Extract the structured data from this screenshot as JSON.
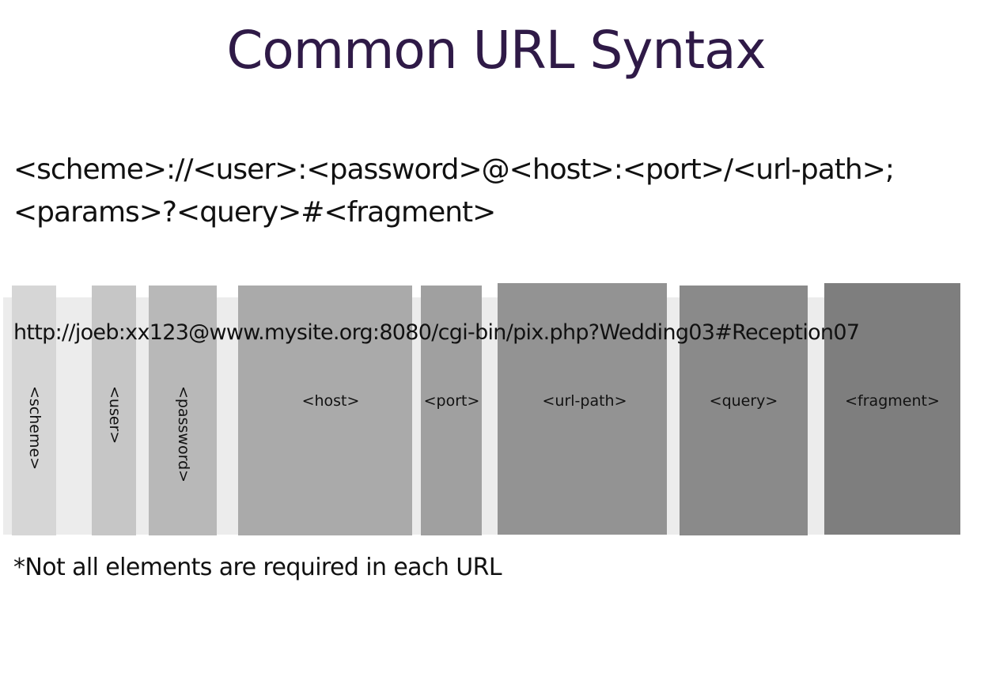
{
  "title": "Common URL Syntax",
  "syntax": {
    "line1": "<scheme>://<user>:<password>@<host>:<port>/<url-path>;",
    "line2": "<params>?<query>#<fragment>"
  },
  "diagram": {
    "example_url": "http://joeb:xx123@www.mysite.org:8080/cgi-bin/pix.php?Wedding03#Reception07",
    "components": [
      {
        "label": "<scheme>",
        "orientation": "vertical",
        "color": "#d6d6d6"
      },
      {
        "label": "<user>",
        "orientation": "vertical",
        "color": "#c6c6c6"
      },
      {
        "label": "<password>",
        "orientation": "vertical",
        "color": "#b8b8b8"
      },
      {
        "label": "<host>",
        "orientation": "horizontal",
        "color": "#aaaaaa"
      },
      {
        "label": "<port>",
        "orientation": "horizontal",
        "color": "#a0a0a0"
      },
      {
        "label": "<url-path>",
        "orientation": "horizontal",
        "color": "#939393"
      },
      {
        "label": "<query>",
        "orientation": "horizontal",
        "color": "#8a8a8a"
      },
      {
        "label": "<fragment>",
        "orientation": "horizontal",
        "color": "#7e7e7e"
      }
    ]
  },
  "footnote": "*Not all elements are required in each URL"
}
